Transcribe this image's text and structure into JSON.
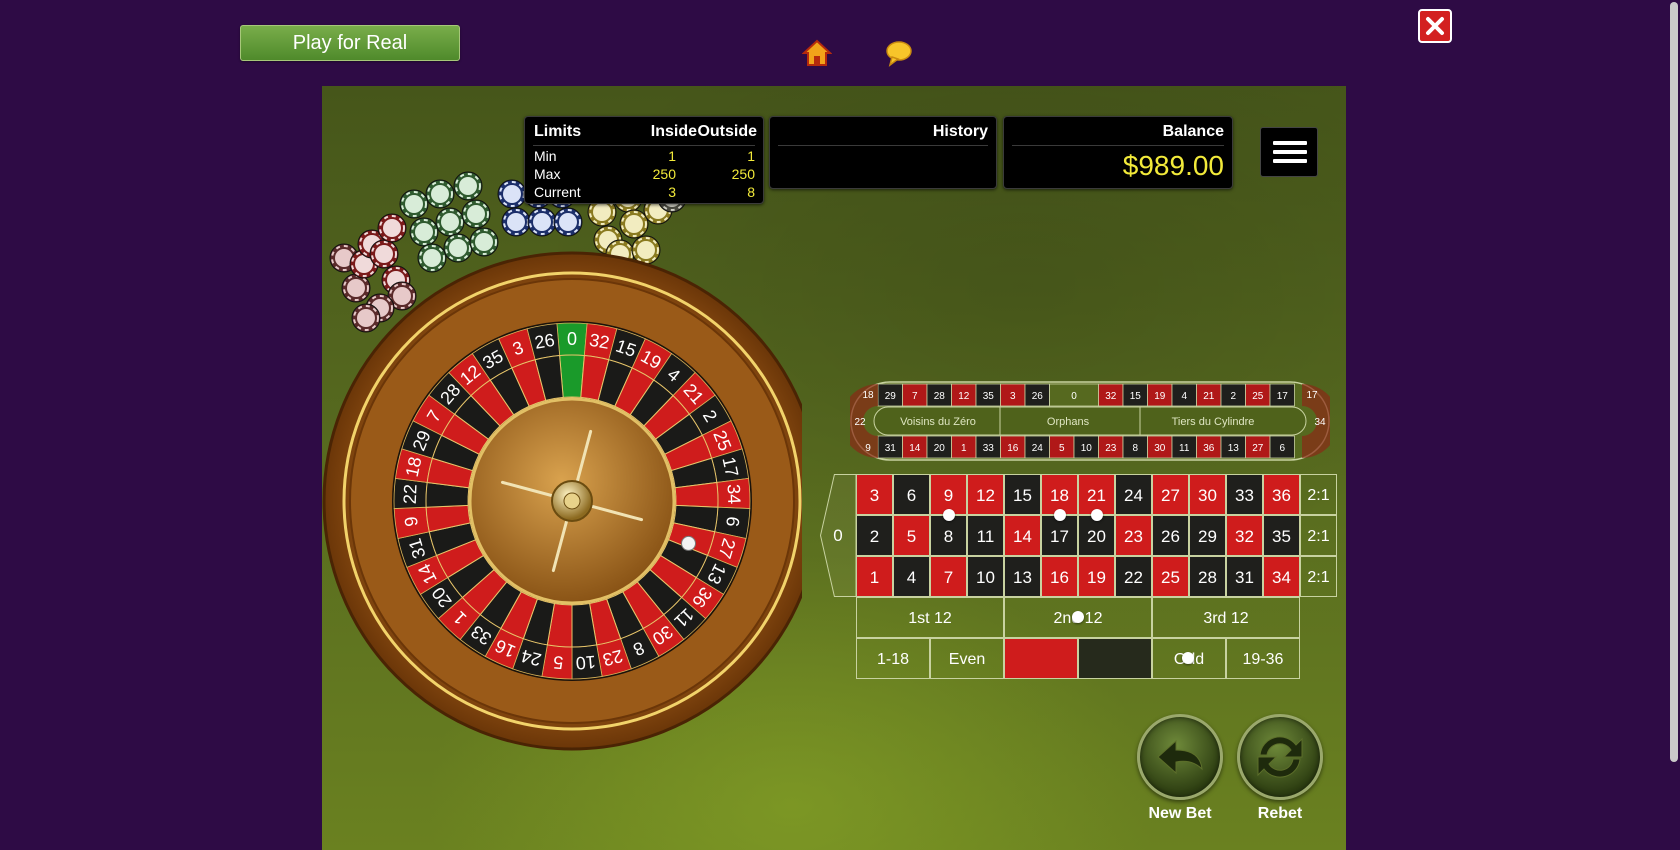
{
  "top_bar": {
    "play_real_label": "Play for Real",
    "home_icon": "home-icon",
    "chat_icon": "chat-bubble-icon",
    "close_icon": "close-icon"
  },
  "limits": {
    "title": "Limits",
    "col_inside": "Inside",
    "col_outside": "Outside",
    "rows": [
      {
        "label": "Min",
        "inside": "1",
        "outside": "1"
      },
      {
        "label": "Max",
        "inside": "250",
        "outside": "250"
      },
      {
        "label": "Current",
        "inside": "3",
        "outside": "8"
      }
    ]
  },
  "history": {
    "title": "History"
  },
  "balance": {
    "title": "Balance",
    "value": "$989.00"
  },
  "menu": {
    "icon": "hamburger-menu-icon"
  },
  "colors": {
    "red": "#cf1c1c",
    "black": "#1f1f1c",
    "green": "#1a9a2a",
    "balance_text": "#f2ea3a",
    "background": "#2e0b45"
  },
  "wheel": {
    "numbers": [
      "0",
      "32",
      "15",
      "19",
      "4",
      "21",
      "2",
      "25",
      "17",
      "34",
      "6",
      "27",
      "13",
      "36",
      "11",
      "30",
      "8",
      "23",
      "10",
      "5",
      "24",
      "16",
      "33",
      "1",
      "20",
      "14",
      "31",
      "9",
      "22",
      "18",
      "29",
      "7",
      "28",
      "12",
      "35",
      "3",
      "26"
    ]
  },
  "racetrack": {
    "top_row": [
      "18",
      "29",
      "7",
      "28",
      "12",
      "35",
      "3",
      "26",
      "0",
      "32",
      "15",
      "19",
      "4",
      "21",
      "2",
      "25",
      "17"
    ],
    "bottom_row": [
      "9",
      "31",
      "14",
      "20",
      "1",
      "33",
      "16",
      "24",
      "5",
      "10",
      "23",
      "8",
      "30",
      "11",
      "36",
      "13",
      "27",
      "6"
    ],
    "left_end": "22",
    "right_end": "34",
    "sections": [
      "Voisins du Zéro",
      "Orphans",
      "Tiers du Cylindre"
    ]
  },
  "table": {
    "zero": "0",
    "rows": [
      [
        "3",
        "6",
        "9",
        "12",
        "15",
        "18",
        "21",
        "24",
        "27",
        "30",
        "33",
        "36"
      ],
      [
        "2",
        "5",
        "8",
        "11",
        "14",
        "17",
        "20",
        "23",
        "26",
        "29",
        "32",
        "35"
      ],
      [
        "1",
        "4",
        "7",
        "10",
        "13",
        "16",
        "19",
        "22",
        "25",
        "28",
        "31",
        "34"
      ]
    ],
    "column_bets": [
      "2:1",
      "2:1",
      "2:1"
    ],
    "dozens": [
      "1st 12",
      "2nd 12",
      "3rd 12"
    ],
    "even_money": [
      "1-18",
      "Even",
      "",
      "",
      "Odd",
      "19-36"
    ]
  },
  "buttons": {
    "new_bet": "New Bet",
    "rebet": "Rebet"
  }
}
